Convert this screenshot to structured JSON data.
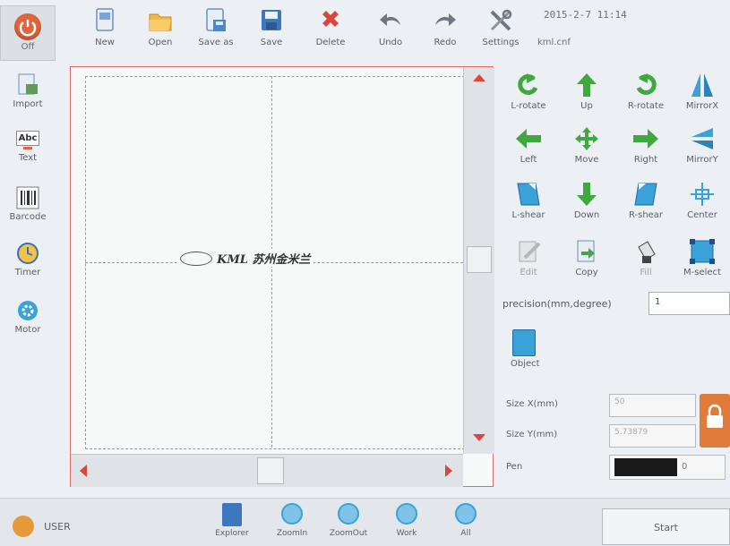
{
  "clock": "2015-2-7 11:14",
  "filename": "kml.cnf",
  "power": {
    "label": "Off"
  },
  "toolbar": [
    {
      "id": "new",
      "label": "New",
      "icon": "new-file-icon"
    },
    {
      "id": "open",
      "label": "Open",
      "icon": "folder-icon"
    },
    {
      "id": "saveas",
      "label": "Save as",
      "icon": "save-as-icon"
    },
    {
      "id": "save",
      "label": "Save",
      "icon": "floppy-icon"
    },
    {
      "id": "delete",
      "label": "Delete",
      "icon": "delete-x-icon"
    },
    {
      "id": "undo",
      "label": "Undo",
      "icon": "undo-arrow-icon"
    },
    {
      "id": "redo",
      "label": "Redo",
      "icon": "redo-arrow-icon"
    },
    {
      "id": "settings",
      "label": "Settings",
      "icon": "wrench-icon"
    }
  ],
  "sidebar": [
    {
      "id": "import",
      "label": "Import",
      "icon": "import-icon"
    },
    {
      "id": "text",
      "label": "Text",
      "icon": "text-abc-icon",
      "glyph": "Abc"
    },
    {
      "id": "barcode",
      "label": "Barcode",
      "icon": "barcode-icon"
    },
    {
      "id": "timer",
      "label": "Timer",
      "icon": "clock-icon"
    },
    {
      "id": "motor",
      "label": "Motor",
      "icon": "gear-icon"
    }
  ],
  "canvas": {
    "logo_text": "KML 苏州金米兰"
  },
  "tools": [
    {
      "id": "lrotate",
      "label": "L-rotate",
      "icon": "rotate-left-icon"
    },
    {
      "id": "up",
      "label": "Up",
      "icon": "arrow-up-icon"
    },
    {
      "id": "rrotate",
      "label": "R-rotate",
      "icon": "rotate-right-icon"
    },
    {
      "id": "mirrorx",
      "label": "MirrorX",
      "icon": "mirror-x-icon"
    },
    {
      "id": "left",
      "label": "Left",
      "icon": "arrow-left-icon"
    },
    {
      "id": "move",
      "label": "Move",
      "icon": "move-cross-icon"
    },
    {
      "id": "right",
      "label": "Right",
      "icon": "arrow-right-icon"
    },
    {
      "id": "mirrory",
      "label": "MirrorY",
      "icon": "mirror-y-icon"
    },
    {
      "id": "lshear",
      "label": "L-shear",
      "icon": "shear-left-icon"
    },
    {
      "id": "down",
      "label": "Down",
      "icon": "arrow-down-icon"
    },
    {
      "id": "rshear",
      "label": "R-shear",
      "icon": "shear-right-icon"
    },
    {
      "id": "center",
      "label": "Center",
      "icon": "center-icon"
    },
    {
      "id": "edit",
      "label": "Edit",
      "icon": "edit-pencil-icon"
    },
    {
      "id": "copy",
      "label": "Copy",
      "icon": "copy-icon"
    },
    {
      "id": "fill",
      "label": "Fill",
      "icon": "fill-bucket-icon"
    },
    {
      "id": "mselect",
      "label": "M-select",
      "icon": "multi-select-icon"
    }
  ],
  "precision": {
    "label": "precision(mm,degree)",
    "value": "1"
  },
  "object": {
    "label": "Object"
  },
  "size_x": {
    "label": "Size X(mm)",
    "value": "50"
  },
  "size_y": {
    "label": "Size Y(mm)",
    "value": "5.73879"
  },
  "pen": {
    "label": "Pen",
    "value": "0",
    "color": "#1a1a1a"
  },
  "bottom": {
    "user": "USER",
    "start": "Start",
    "buttons": [
      {
        "id": "explorer",
        "label": "Explorer",
        "icon": "explorer-icon"
      },
      {
        "id": "zoomin",
        "label": "ZoomIn",
        "icon": "zoom-in-icon"
      },
      {
        "id": "zoomout",
        "label": "ZoomOut",
        "icon": "zoom-out-icon"
      },
      {
        "id": "work",
        "label": "Work",
        "icon": "work-icon"
      },
      {
        "id": "all",
        "label": "All",
        "icon": "zoom-all-icon"
      }
    ]
  },
  "colors": {
    "accent": "#3aa2d8",
    "green": "#3fa83f",
    "red": "#d9473a",
    "power": "#e0653c",
    "lock": "#e07b3a"
  }
}
